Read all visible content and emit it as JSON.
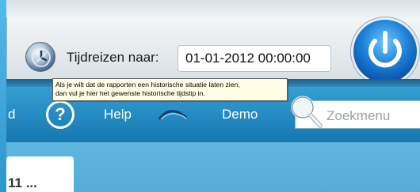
{
  "time_travel": {
    "label": "Tijdreizen naar:",
    "date_value": "01-01-2012 00:00:00",
    "tooltip_line1": "Als je wilt dat de rapporten een historische situatie laten zien,",
    "tooltip_line2": "dan vul je hier het gewenste historische tijdstip in."
  },
  "nav": {
    "partial_left": "d",
    "help_label": "Help",
    "demo_label": "Demo",
    "help_glyph": "?"
  },
  "search": {
    "placeholder": "Zoekmenu"
  },
  "content": {
    "card_text": "11 ..."
  },
  "icons": {
    "time_travel": "clock-globe-icon",
    "power": "power-icon",
    "help": "help-icon",
    "demo": "demo-icon",
    "search": "magnifier-icon"
  }
}
